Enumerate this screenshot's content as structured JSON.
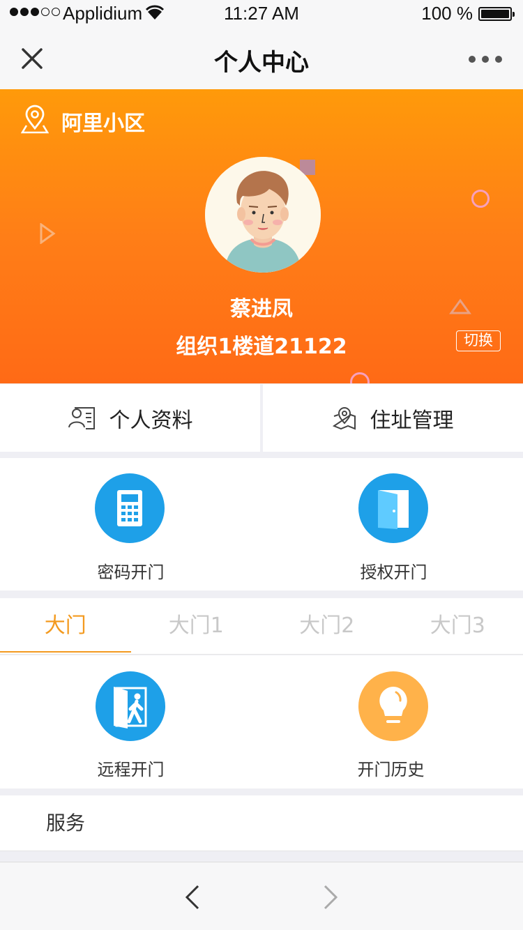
{
  "status_bar": {
    "carrier": "Applidium",
    "time": "11:27 AM",
    "battery": "100 %"
  },
  "nav": {
    "title": "个人中心",
    "close_icon": "close-icon",
    "more_icon": "more-icon"
  },
  "hero": {
    "community": "阿里小区",
    "name": "蔡进凤",
    "address": "组织1楼道21122",
    "switch_label": "切换",
    "background_colors": [
      "#ff9a0a",
      "#ff6a16"
    ]
  },
  "profile_links": [
    {
      "label": "个人资料",
      "icon": "profile-card-icon"
    },
    {
      "label": "住址管理",
      "icon": "address-map-icon"
    }
  ],
  "door_actions": [
    {
      "label": "密码开门",
      "icon": "keypad-icon",
      "color": "#1ea0e8"
    },
    {
      "label": "授权开门",
      "icon": "door-icon",
      "color": "#1ea0e8"
    }
  ],
  "gate_tabs": [
    {
      "label": "大门",
      "active": true
    },
    {
      "label": "大门1",
      "active": false
    },
    {
      "label": "大门2",
      "active": false
    },
    {
      "label": "大门3",
      "active": false
    }
  ],
  "gate_actions": [
    {
      "label": "远程开门",
      "icon": "walk-through-door-icon",
      "color": "#1ea0e8"
    },
    {
      "label": "开门历史",
      "icon": "lightbulb-icon",
      "color": "#ffb24a"
    }
  ],
  "service": {
    "label": "服务"
  },
  "accent_color": "#f39a1f"
}
